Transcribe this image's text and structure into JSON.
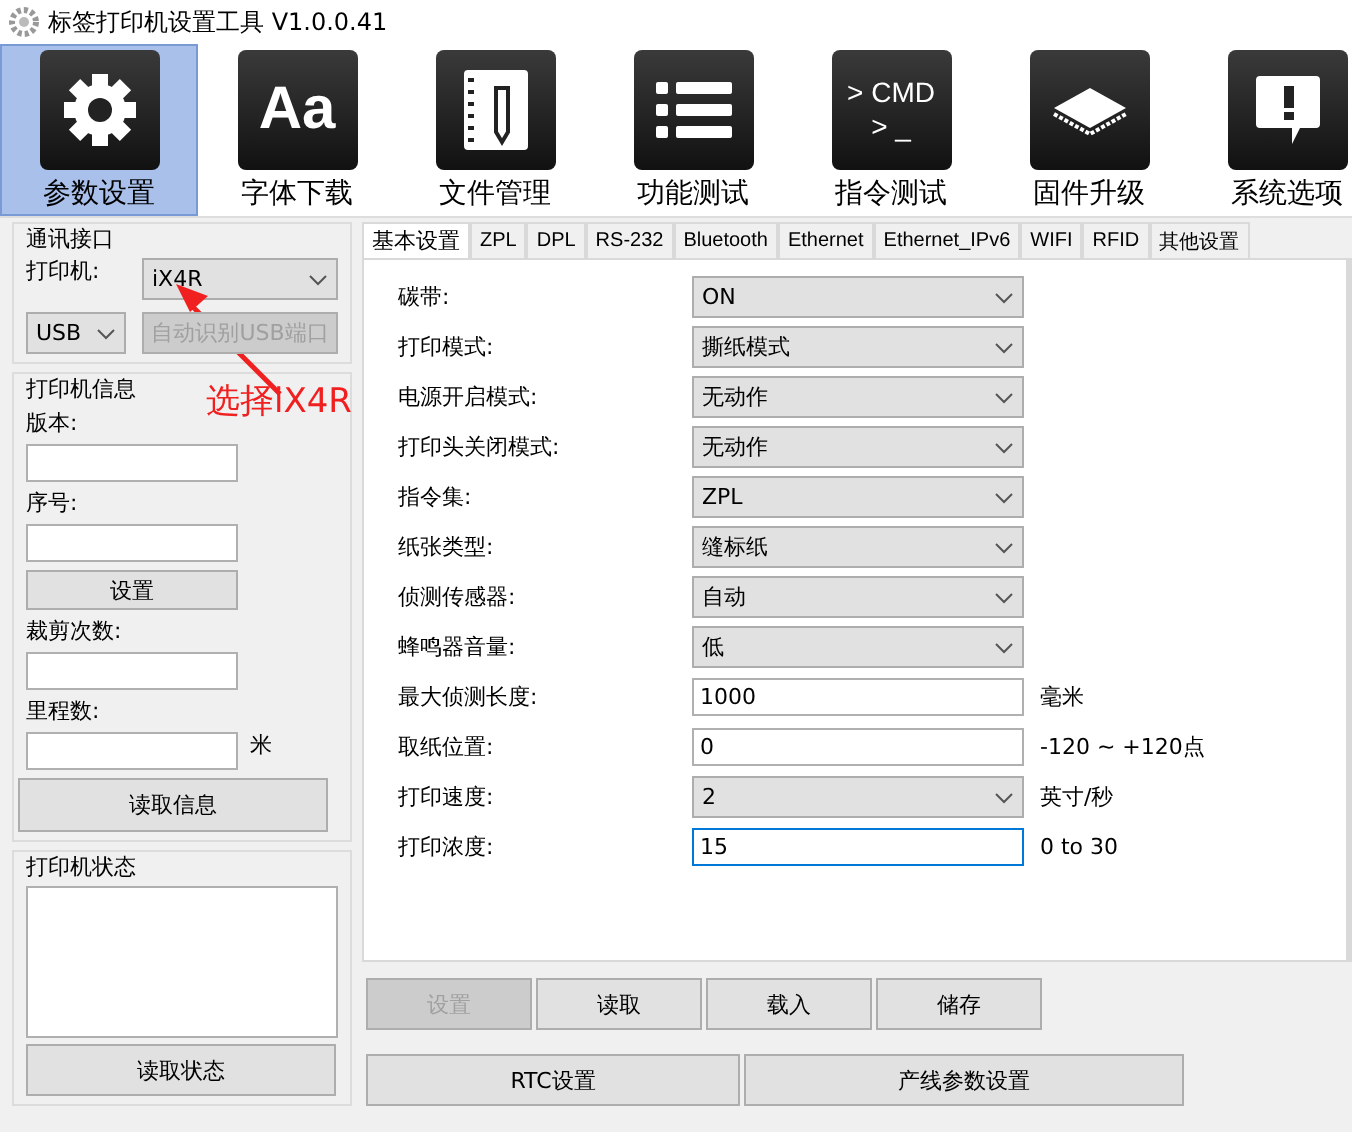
{
  "window": {
    "title": "标签打印机设置工具  V1.0.0.41"
  },
  "toolbar": [
    {
      "kind": "gear",
      "label": "参数设置",
      "selected": true
    },
    {
      "kind": "text",
      "icon_text": "Aa",
      "label": "字体下载",
      "selected": false
    },
    {
      "kind": "notebook",
      "label": "文件管理",
      "selected": false
    },
    {
      "kind": "list",
      "label": "功能测试",
      "selected": false
    },
    {
      "kind": "cmd",
      "icon_text": "> CMD\n> _",
      "label": "指令测试",
      "selected": false
    },
    {
      "kind": "chip",
      "label": "固件升级",
      "selected": false
    },
    {
      "kind": "bubble",
      "label": "系统选项",
      "selected": false
    }
  ],
  "connection": {
    "title": "通讯接口",
    "printer_label": "打印机:",
    "printer": "iX4R",
    "port": "USB",
    "auto_button": "自动识别USB端口",
    "auto_disabled": true
  },
  "annotation": {
    "text": "选择iX4R"
  },
  "printer_info": {
    "title": "打印机信息",
    "version_label": "版本:",
    "serial_label": "序号:",
    "set_button": "设置",
    "cuts_label": "裁剪次数:",
    "mileage_label": "里程数:",
    "mileage_unit": "米",
    "read_button": "读取信息"
  },
  "printer_status": {
    "title": "打印机状态",
    "read_button": "读取状态"
  },
  "tabs": [
    {
      "label": "基本设置",
      "selected": true
    },
    {
      "label": "ZPL",
      "selected": false
    },
    {
      "label": "DPL",
      "selected": false
    },
    {
      "label": "RS-232",
      "selected": false
    },
    {
      "label": "Bluetooth",
      "selected": false
    },
    {
      "label": "Ethernet",
      "selected": false
    },
    {
      "label": "Ethernet_IPv6",
      "selected": false
    },
    {
      "label": "WIFI",
      "selected": false
    },
    {
      "label": "RFID",
      "selected": false
    },
    {
      "label": "其他设置",
      "selected": false
    }
  ],
  "settings": [
    {
      "kind": "select",
      "label": "碳带:",
      "value": "ON"
    },
    {
      "kind": "select",
      "label": "打印模式:",
      "value": "撕纸模式"
    },
    {
      "kind": "select",
      "label": "电源开启模式:",
      "value": "无动作"
    },
    {
      "kind": "select",
      "label": "打印头关闭模式:",
      "value": "无动作"
    },
    {
      "kind": "select",
      "label": "指令集:",
      "value": "ZPL"
    },
    {
      "kind": "select",
      "label": "纸张类型:",
      "value": "缝标纸"
    },
    {
      "kind": "select",
      "label": "侦测传感器:",
      "value": "自动"
    },
    {
      "kind": "select",
      "label": "蜂鸣器音量:",
      "value": "低"
    },
    {
      "kind": "input",
      "label": "最大侦测长度:",
      "value": "1000",
      "unit": "毫米"
    },
    {
      "kind": "input",
      "label": "取纸位置:",
      "value": "0",
      "unit": "-120 ~ +120点"
    },
    {
      "kind": "select",
      "label": "打印速度:",
      "value": "2",
      "unit": "英寸/秒"
    },
    {
      "kind": "input",
      "label": "打印浓度:",
      "value": "15",
      "unit": "0 to 30",
      "focused": true
    }
  ],
  "actions": [
    {
      "label": "设置",
      "disabled": true
    },
    {
      "label": "读取",
      "disabled": false
    },
    {
      "label": "载入",
      "disabled": false
    },
    {
      "label": "储存",
      "disabled": false
    }
  ],
  "extra_buttons": [
    "RTC设置",
    "产线参数设置"
  ]
}
